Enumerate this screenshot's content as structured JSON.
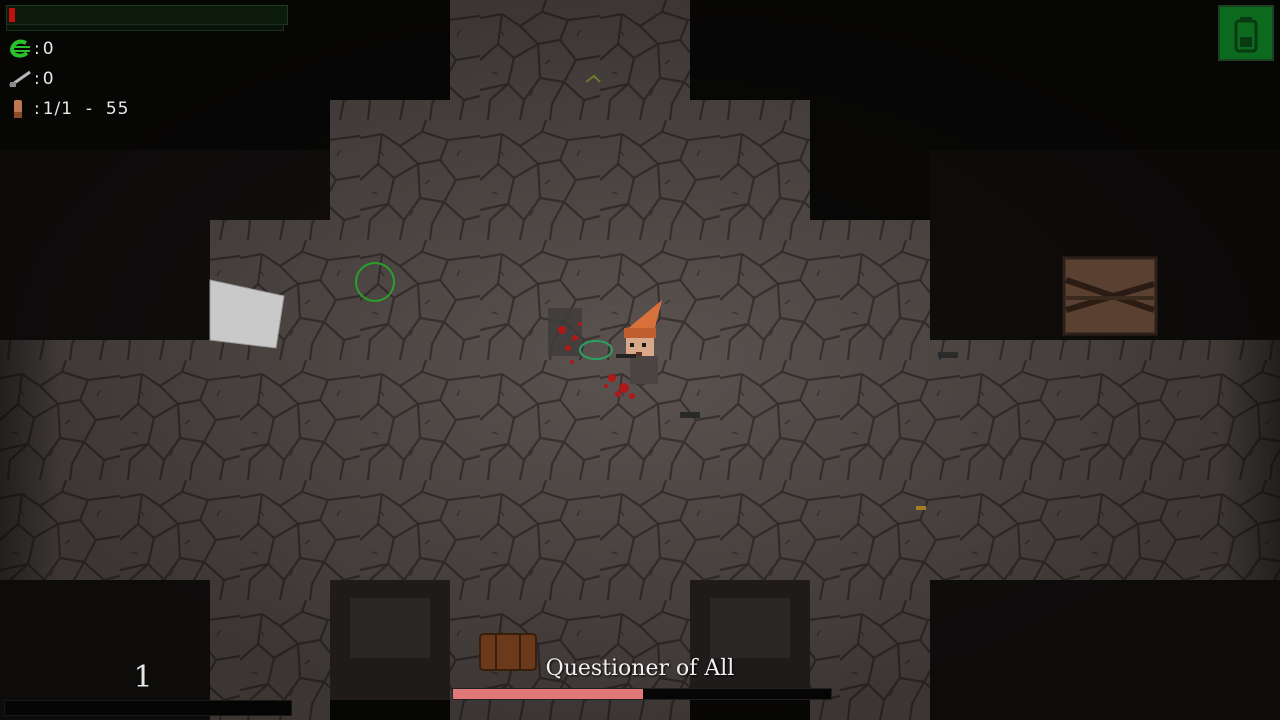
{
  "player": {
    "health_fraction": 0.02,
    "xp_fraction": 0.0
  },
  "inventory": {
    "currency_icon": "green-currency-icon",
    "currency_value": "0",
    "weapon_icon": "rifle-icon",
    "weapon_value": "0",
    "ammo_icon": "ammo-shell-icon",
    "ammo_value": "1/1  -  55",
    "separator": ":"
  },
  "battery": {
    "icon": "battery-icon",
    "color": "#0b6a1e"
  },
  "wave": {
    "number": "1"
  },
  "boss": {
    "name": "Questioner of All",
    "health_fraction": 0.503,
    "bar_color": "#e07878"
  },
  "colors": {
    "floor": "#5b5350",
    "crack": "#3a3331",
    "wall_dark": "#0a0908",
    "crosshair": "#2aa02a"
  }
}
